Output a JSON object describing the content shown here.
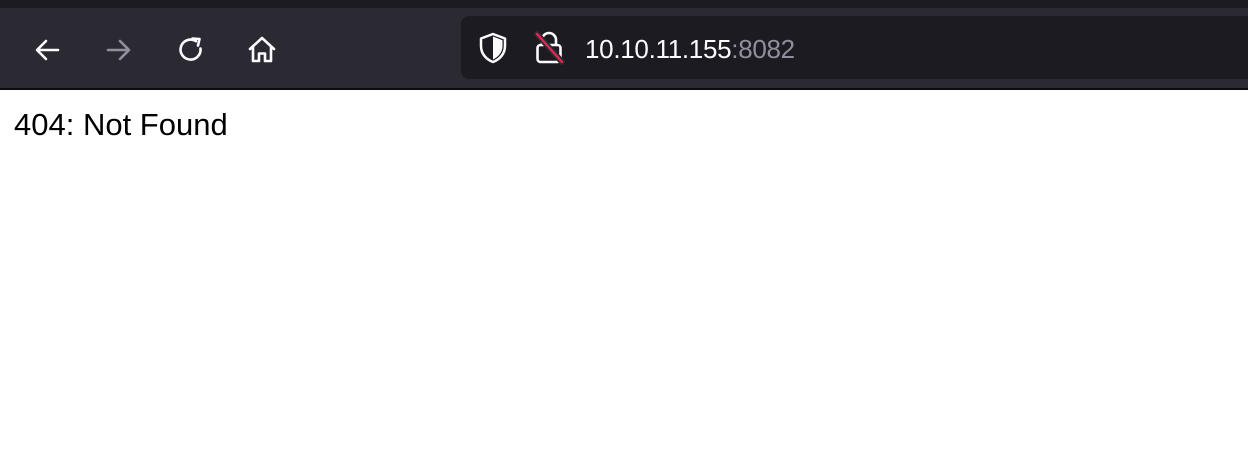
{
  "toolbar": {
    "back_icon": "arrow-left-icon",
    "forward_icon": "arrow-right-icon",
    "reload_icon": "reload-icon",
    "home_icon": "home-icon"
  },
  "urlbar": {
    "host": "10.10.11.155",
    "port": ":8082",
    "tracking_icon": "shield-icon",
    "security_icon": "insecure-lock-icon"
  },
  "page": {
    "body_text": "404: Not Found"
  },
  "colors": {
    "toolbar_bg": "#2b2a33",
    "urlbar_bg": "#1c1b22",
    "icon_active": "#fbfbfe",
    "icon_disabled": "#8f8f9d",
    "insecure_slash": "#e22850"
  }
}
